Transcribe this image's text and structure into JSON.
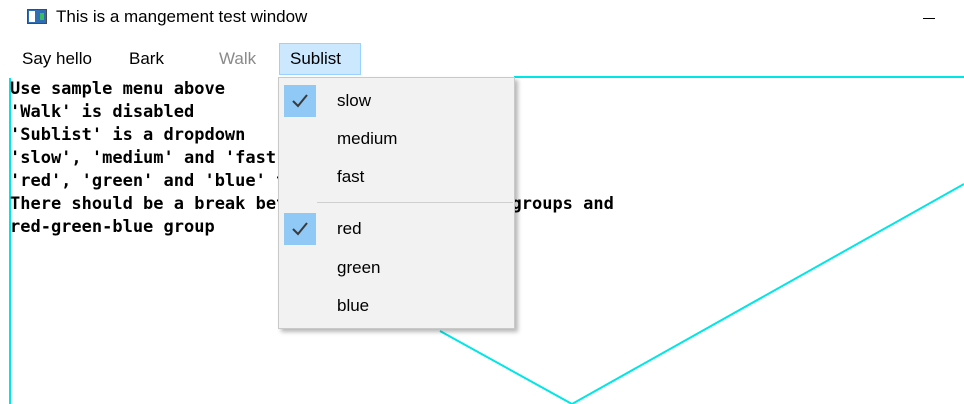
{
  "window": {
    "title": "This is a mangement test window",
    "icon": "app-window-icon",
    "minimize_icon": "minimize-icon"
  },
  "menubar": {
    "items": [
      {
        "label": "Say hello",
        "enabled": true
      },
      {
        "label": "Bark",
        "enabled": true
      },
      {
        "label": "Walk",
        "enabled": false
      },
      {
        "label": "Sublist",
        "enabled": true,
        "open": true
      }
    ]
  },
  "content": {
    "lines": [
      "Use sample menu above",
      "'Walk' is disabled",
      "'Sublist' is a dropdown",
      "'slow', 'medium' and 'fast' are a one/of list",
      "'red', 'green' and 'blue' too",
      "There should be a break between slow-medium-fast groups and",
      "red-green-blue group"
    ],
    "line_color": "#00e5e5"
  },
  "dropdown": {
    "groups": [
      {
        "items": [
          {
            "label": "slow",
            "checked": true
          },
          {
            "label": "medium",
            "checked": false
          },
          {
            "label": "fast",
            "checked": false
          }
        ]
      },
      {
        "items": [
          {
            "label": "red",
            "checked": true
          },
          {
            "label": "green",
            "checked": false
          },
          {
            "label": "blue",
            "checked": false
          }
        ]
      }
    ],
    "check_icon": "checkmark-icon",
    "check_color": "#90c8f6"
  }
}
